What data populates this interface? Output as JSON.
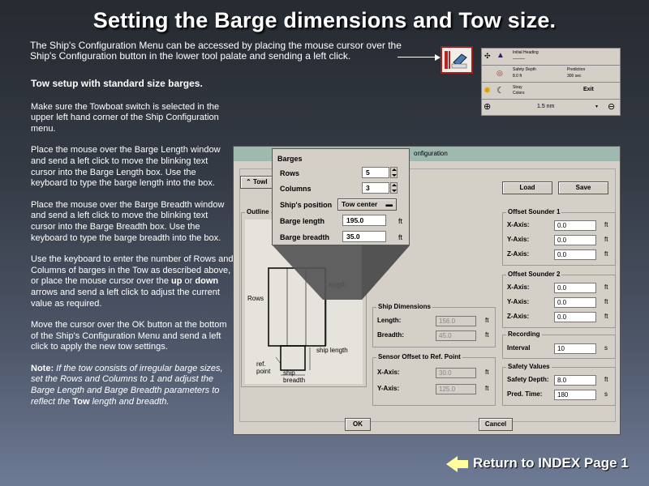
{
  "title": "Setting the Barge dimensions and Tow size.",
  "intro": "The Ship's Configuration Menu can be accessed by placing the mouse cursor over the Ship's Configuration button in the lower tool palate and sending a left click.",
  "left": {
    "heading": "Tow setup with standard size barges.",
    "p1": "Make sure the Towboat switch is selected in the upper left hand corner of the Ship Configuration menu.",
    "p2": "Place the mouse over the Barge Length window and send a left click to move the blinking text cursor into the Barge Length box.  Use the keyboard to type the barge length into the box.",
    "p3": "Place the mouse over the Barge Breadth window and send a left click to move the blinking text cursor into the Barge Breadth box.  Use the keyboard to type the barge breadth into the box.",
    "p4a": "Use the keyboard to enter the number of Rows and Columns of barges in the Tow as described above, or place the mouse cursor over the ",
    "up": "up",
    "or": " or ",
    "down": "down",
    "p4b": " arrows and send a left click to adjust the current value as required.",
    "p5": "Move the cursor over the OK button at the bottom of the Ship's Configuration Menu and send a left click to apply the new tow settings.",
    "note_label": "Note:",
    "note_a": "  If the tow consists of irregular barge sizes, set the Rows and Columns to 1 and adjust the Barge Length and Barge Breadth parameters to reflect the ",
    "note_tow": "Tow",
    "note_b": " length and breadth."
  },
  "toolbar": {
    "r1a": "Initial Heading",
    "r1b": "———",
    "r2a": "Safety Depth",
    "r2a_v": "8.0 ft",
    "r2b": "Prediction",
    "r2b_v": "300 sec",
    "r3a": "Stray",
    "r3a_v": "Colors",
    "exit": "Exit",
    "zoom": "1.5 nm"
  },
  "dialog": {
    "title": "onfiguration",
    "tow_prefix": "Towl",
    "load": "Load",
    "save": "Save",
    "outline": "Outline",
    "diagram": {
      "rows": "Rows",
      "length": "length",
      "ship_length": "ship length",
      "ref_point": "ref. point",
      "ship_breadth": "ship breadth"
    },
    "ship_dims": {
      "label": "Ship Dimensions",
      "length_lbl": "Length:",
      "length": "156.0",
      "breadth_lbl": "Breadth:",
      "breadth": "45.0",
      "unit": "ft"
    },
    "sensor": {
      "label": "Sensor Offset to Ref. Point",
      "x_lbl": "X-Axis:",
      "x": "30.0",
      "y_lbl": "Y-Axis:",
      "y": "125.0",
      "unit": "ft"
    },
    "sounder1": {
      "label": "Offset Sounder 1",
      "x_lbl": "X-Axis:",
      "x": "0.0",
      "y_lbl": "Y-Axis:",
      "y": "0.0",
      "z_lbl": "Z-Axis:",
      "z": "0.0",
      "unit": "ft"
    },
    "sounder2": {
      "label": "Offset Sounder 2",
      "x_lbl": "X-Axis:",
      "x": "0.0",
      "y_lbl": "Y-Axis:",
      "y": "0.0",
      "z_lbl": "Z-Axis:",
      "z": "0.0",
      "unit": "ft"
    },
    "recording": {
      "label": "Recording",
      "interval_lbl": "Interval",
      "interval": "10",
      "unit": "s"
    },
    "safety": {
      "label": "Safety Values",
      "depth_lbl": "Safety Depth:",
      "depth": "8.0",
      "depth_unit": "ft",
      "time_lbl": "Pred. Time:",
      "time": "180",
      "time_unit": "s"
    },
    "ok": "OK",
    "cancel": "Cancel"
  },
  "barges": {
    "label": "Barges",
    "rows_lbl": "Rows",
    "rows": "5",
    "cols_lbl": "Columns",
    "cols": "3",
    "pos_lbl": "Ship's position",
    "pos": "Tow center",
    "len_lbl": "Barge length",
    "len": "195.0",
    "br_lbl": "Barge breadth",
    "br": "35.0",
    "unit": "ft"
  },
  "return_link": "Return to INDEX Page 1"
}
